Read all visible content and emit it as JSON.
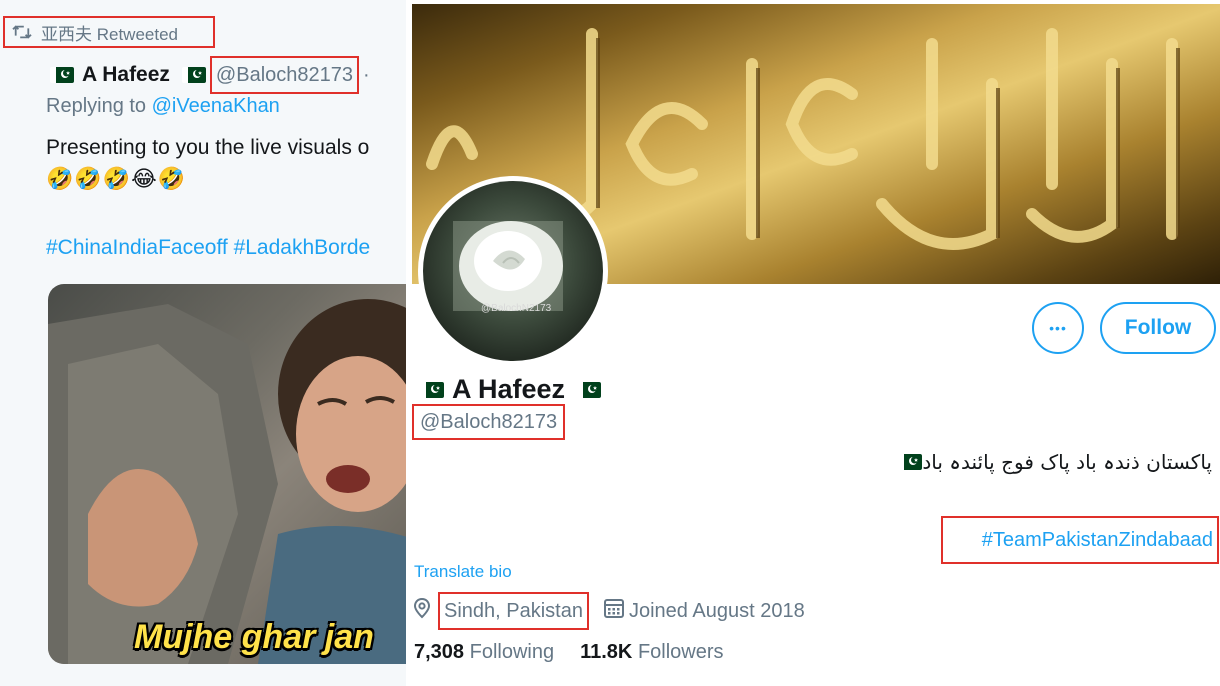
{
  "tweet": {
    "retweeted_by": "亚西夫 Retweeted",
    "author_name": "A Hafeez",
    "author_handle": "@Baloch82173",
    "handle_separator": "·",
    "replying_prefix": "Replying to ",
    "replying_to": "@iVeenaKhan",
    "text": "Presenting to you the live visuals o",
    "emojis": "🤣🤣🤣😂🤣",
    "hashtags": "#ChinaIndiaFaceoff #LadakhBorde",
    "media_caption": "Mujhe ghar jan"
  },
  "profile": {
    "name": "A Hafeez",
    "handle": "@Baloch82173",
    "follow_label": "Follow",
    "more_label": "•••",
    "avatar_watermark": "@BalochN2173",
    "bio_urdu": "پاکستان ذندہ باد پاک فوج پائندہ باد",
    "bio_hashtag": "#TeamPakistanZindabaad",
    "translate_label": "Translate bio",
    "location": "Sindh, Pakistan",
    "joined": "Joined August 2018",
    "following_count": "7,308",
    "following_label": "Following",
    "followers_count": "11.8K",
    "followers_label": "Followers"
  },
  "icons": {
    "retweet": "retweet-icon",
    "flag": "pakistan-flag-icon",
    "more": "more-options-icon",
    "location": "location-pin-icon",
    "calendar": "calendar-icon"
  },
  "colors": {
    "twitter_blue": "#1da1f2",
    "secondary_text": "#657786",
    "highlight_box": "#e0302a",
    "flag_green": "#01411c"
  }
}
